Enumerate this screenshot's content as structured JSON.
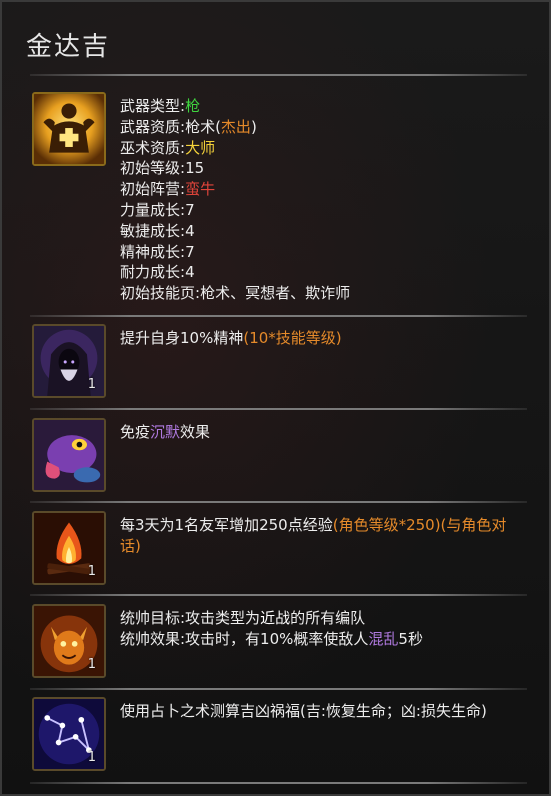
{
  "title": "金达吉",
  "hero": {
    "stats": [
      {
        "label": "武器类型:",
        "value": "枪",
        "value_color": "green"
      },
      {
        "label": "武器资质:",
        "value": "枪术(",
        "highlight": "杰出",
        "suffix": ")",
        "highlight_color": "orange"
      },
      {
        "label": "巫术资质:",
        "value": "大师",
        "value_color": "yellow"
      },
      {
        "label": "初始等级:",
        "value": "15",
        "value_color": "white"
      },
      {
        "label": "初始阵营:",
        "value": "蛮牛",
        "value_color": "red"
      },
      {
        "label": "力量成长:",
        "value": "7",
        "value_color": "white"
      },
      {
        "label": "敏捷成长:",
        "value": "4",
        "value_color": "white"
      },
      {
        "label": "精神成长:",
        "value": "7",
        "value_color": "white"
      },
      {
        "label": "耐力成长:",
        "value": "4",
        "value_color": "white"
      },
      {
        "label": "初始技能页:",
        "value": "枪术、冥想者、欺诈师",
        "value_color": "white"
      }
    ]
  },
  "skills": [
    {
      "icon": "hooded-sage-icon",
      "level": "1",
      "parts": [
        "提升自身10%精神",
        "(10*技能等级)"
      ]
    },
    {
      "icon": "purple-toad-icon",
      "level": "",
      "parts": [
        "免疫",
        "沉默",
        "效果"
      ]
    },
    {
      "icon": "campfire-icon",
      "level": "1",
      "parts": [
        "每3天为1名友军增加250点经验",
        "(角色等级*250)(与角色对话)"
      ]
    },
    {
      "icon": "fire-imp-icon",
      "level": "1",
      "line1": [
        "统帅目标:攻击类型为",
        "近战",
        "的所有编队"
      ],
      "line2": [
        "统帅效果:攻击时，有10%概率使敌人",
        "混乱",
        "5秒"
      ]
    },
    {
      "icon": "constellation-icon",
      "level": "1",
      "parts": [
        "使用占卜之术测算吉凶祸福(吉:恢复生命；凶:损失生命)"
      ]
    }
  ],
  "colors": {
    "green": "#3fd43f",
    "orange": "#e58a2a",
    "yellow": "#f5d23a",
    "red": "#e0443a",
    "purple": "#b07ae0"
  }
}
